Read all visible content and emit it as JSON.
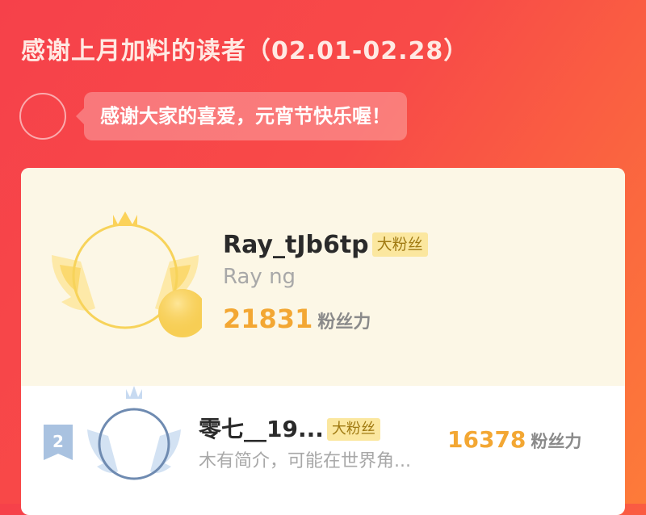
{
  "header": {
    "title": "感谢上月加料的读者（02.01-02.28）"
  },
  "author_message": {
    "text": "感谢大家的喜爱，元宵节快乐喔！"
  },
  "leaderboard": {
    "colors": {
      "accent": "#f3a733",
      "tag_bg": "#fbe79f",
      "gold": "#f7d35a",
      "silver": "#a9c4e4"
    },
    "entries": [
      {
        "rank": "1",
        "name": "Ray_tJb6tp",
        "tag": "大粉丝",
        "desc": "Ray ng",
        "score": "21831",
        "score_unit": "粉丝力",
        "badge_icon": "gold-crown-wings-badge-icon"
      },
      {
        "rank": "2",
        "name": "零七__19...",
        "tag": "大粉丝",
        "desc": "木有简介，可能在世界角...",
        "score": "16378",
        "score_unit": "粉丝力",
        "badge_icon": "silver-crown-wings-badge-icon"
      }
    ]
  }
}
